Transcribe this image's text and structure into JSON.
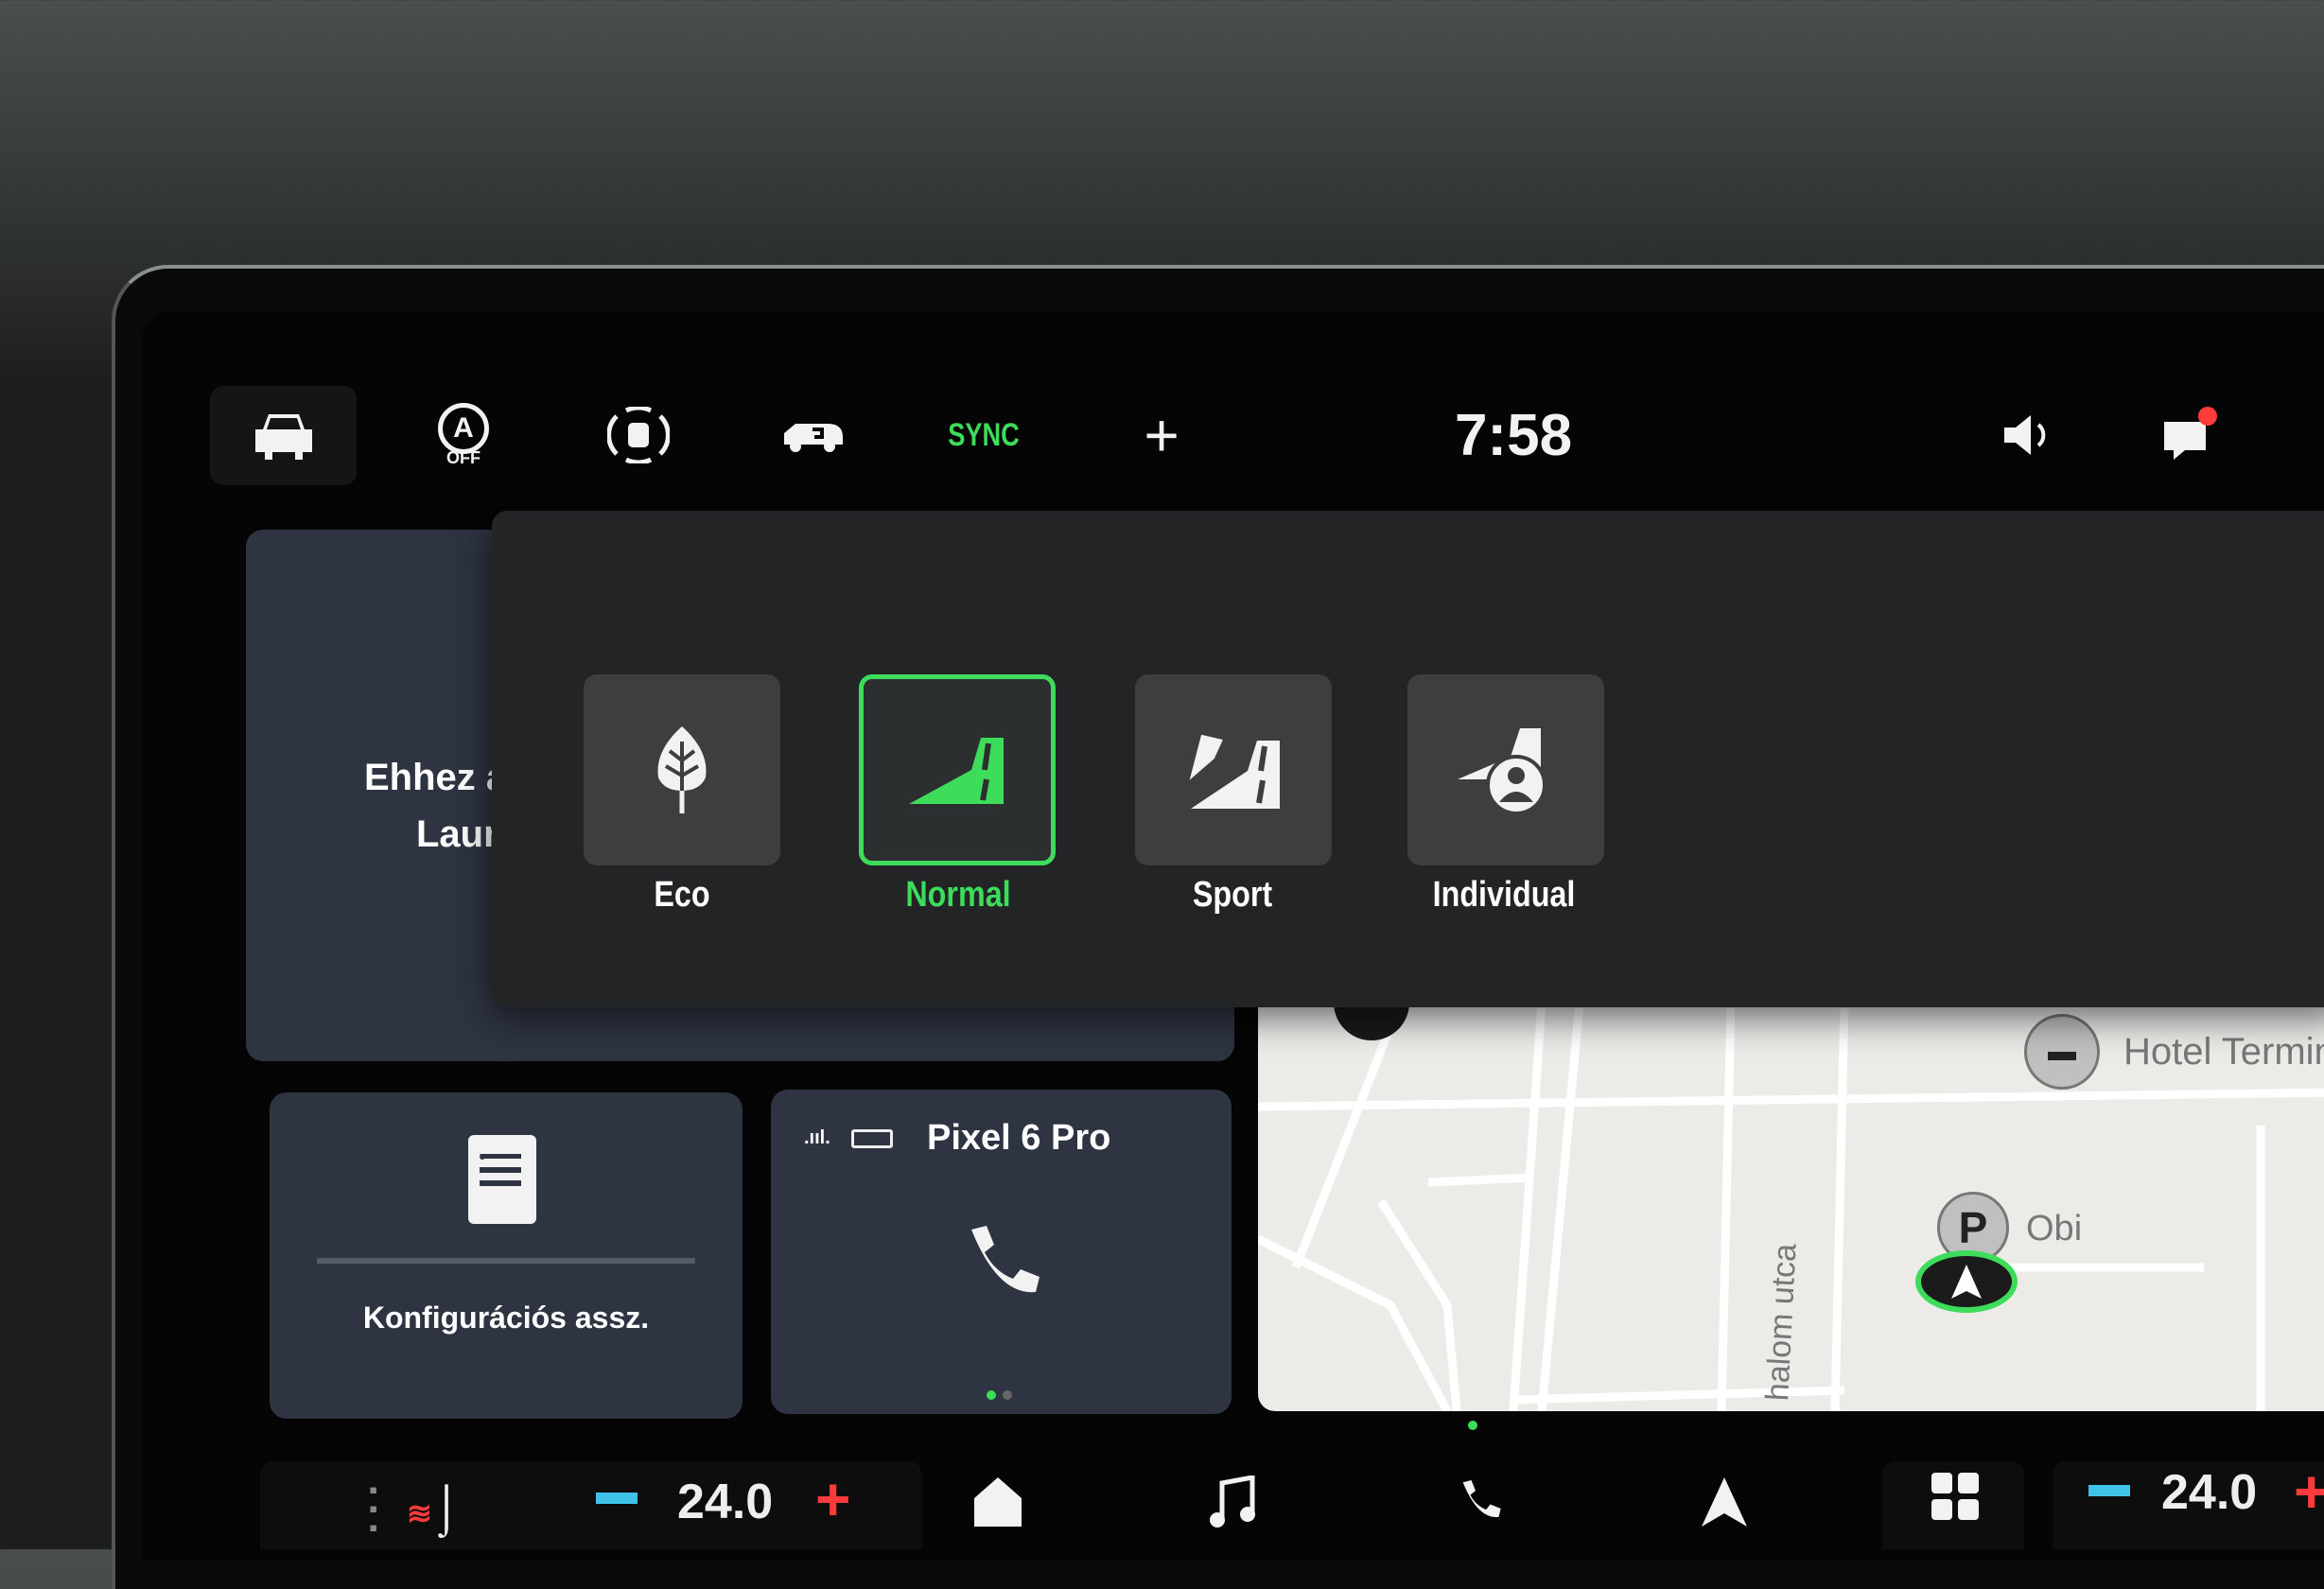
{
  "status_bar": {
    "icons": [
      "car-icon",
      "auto-start-stop-off-icon",
      "parking-sensor-icon",
      "car-swap-icon",
      "plus-icon",
      "volume-icon",
      "notification-icon"
    ],
    "auto_off_label": "OFF",
    "sync_label": "SYNC",
    "time": "7:58",
    "accent": "#3ddc5a"
  },
  "driving_modes": {
    "selected": "Normal",
    "items": [
      {
        "label": "Eco",
        "icon": "leaf-icon"
      },
      {
        "label": "Normal",
        "icon": "road-normal-icon"
      },
      {
        "label": "Sport",
        "icon": "road-flag-icon"
      },
      {
        "label": "Individual",
        "icon": "road-person-icon"
      }
    ]
  },
  "widgets": {
    "welcome_line1": "Ehhez a",
    "welcome_line2": "Laur",
    "config_label": "Konfigurációs assz.",
    "phone_name": "Pixel 6 Pro"
  },
  "map": {
    "poi_hotel": "Hotel Termin",
    "poi_parking": "Obi",
    "parking_symbol": "P",
    "street": "halom utca"
  },
  "bottom_bar": {
    "temp_left": "24.0",
    "temp_right": "24.0",
    "minus": "−",
    "plus": "+",
    "minus_color": "#3fc3e8",
    "plus_color": "#ff3b3b"
  }
}
